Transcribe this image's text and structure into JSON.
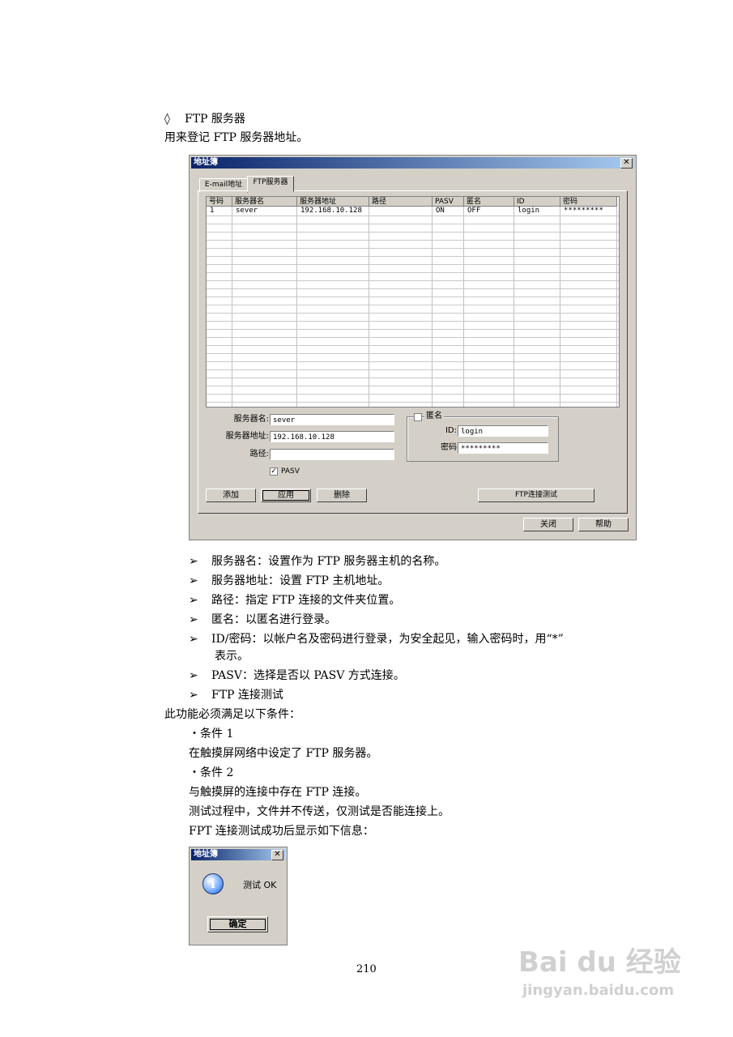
{
  "heading": {
    "marker": "◊",
    "title": "FTP 服务器"
  },
  "intro": "用来登记 FTP 服务器地址。",
  "dialog": {
    "title": "地址簿",
    "close_glyph": "✕",
    "tabs": [
      "E-mail地址",
      "FTP服务器"
    ],
    "columns": [
      "号码",
      "服务器名",
      "服务器地址",
      "路径",
      "PASV",
      "匿名",
      "ID",
      "密码"
    ],
    "rows": [
      [
        "1",
        "sever",
        "192.168.10.128",
        "",
        "ON",
        "OFF",
        "login",
        "*********"
      ]
    ],
    "form": {
      "server_name_label": "服务器名:",
      "server_name_value": "sever",
      "server_addr_label": "服务器地址:",
      "server_addr_value": "192.168.10.128",
      "path_label": "路径:",
      "path_value": "",
      "pasv_label": "PASV",
      "pasv_checked": "✓",
      "anon_label": "匿名",
      "id_label": "ID:",
      "id_value": "login",
      "pwd_label": "密码",
      "pwd_value": "*********"
    },
    "buttons": {
      "add": "添加",
      "apply": "应用",
      "delete": "删除",
      "ftp_test": "FTP连接测试",
      "close": "关闭",
      "help": "帮助"
    }
  },
  "bullets": [
    "服务器名：设置作为 FTP 服务器主机的名称。",
    "服务器地址：设置 FTP 主机地址。",
    "路径：指定 FTP 连接的文件夹位置。",
    "匿名：以匿名进行登录。",
    "ID/密码：以帐户名及密码进行登录，为安全起见，输入密码时，用“*”",
    "PASV：选择是否以 PASV 方式连接。",
    "FTP 连接测试"
  ],
  "bullet_marker": "➢",
  "bullet5_cont": "表示。",
  "body": {
    "cond_intro": "此功能必须满足以下条件：",
    "cond1_title": "・条件 1",
    "cond1_text": "在触摸屏网络中设定了 FTP 服务器。",
    "cond2_title": "・条件 2",
    "cond2_text": "与触摸屏的连接中存在 FTP 连接。",
    "test_note": "测试过程中，文件并不传送，仅测试是否能连接上。",
    "success_note": "FPT 连接测试成功后显示如下信息："
  },
  "msgbox": {
    "title": "地址簿",
    "close_glyph": "✕",
    "info_glyph": "i",
    "message": "测试 OK",
    "ok": "确定"
  },
  "page_number": "210",
  "watermark": {
    "brand": "Bai du 经验",
    "url": "jingyan.baidu.com"
  }
}
